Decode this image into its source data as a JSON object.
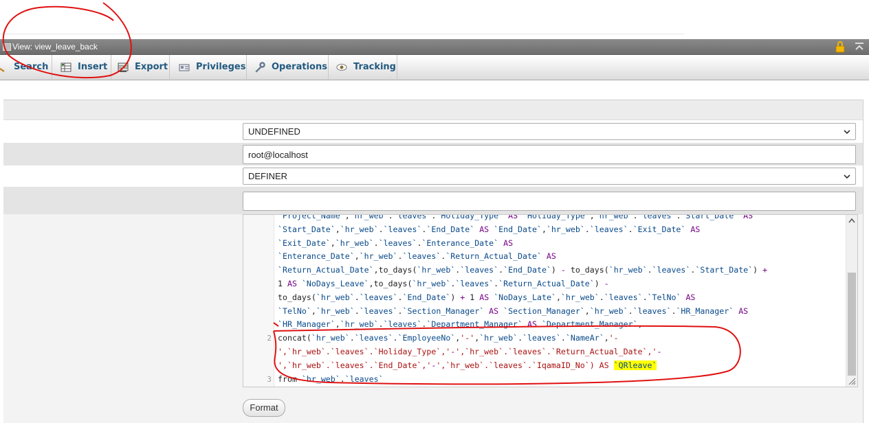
{
  "window": {
    "title": "View: view_leave_back"
  },
  "tabs": [
    {
      "label": "Search",
      "icon": "search-icon"
    },
    {
      "label": "Insert",
      "icon": "insert-icon"
    },
    {
      "label": "Export",
      "icon": "export-icon"
    },
    {
      "label": "Privileges",
      "icon": "privileges-icon"
    },
    {
      "label": "Operations",
      "icon": "wrench-icon"
    },
    {
      "label": "Tracking",
      "icon": "eye-icon"
    }
  ],
  "form": {
    "algorithm": {
      "value": "UNDEFINED"
    },
    "definer": {
      "value": "root@localhost"
    },
    "security": {
      "value": "DEFINER"
    },
    "check_option": {
      "value": ""
    }
  },
  "editor": {
    "lines": [
      {
        "num": "",
        "text": "`Project_Name`,`hr_web`.`leaves`.`Holiday_Type` AS `Holiday_Type`,`hr_web`.`leaves`.`Start_Date` AS"
      },
      {
        "num": "",
        "text": "`Start_Date`,`hr_web`.`leaves`.`End_Date` AS `End_Date`,`hr_web`.`leaves`.`Exit_Date` AS"
      },
      {
        "num": "",
        "text": "`Exit_Date`,`hr_web`.`leaves`.`Enterance_Date` AS"
      },
      {
        "num": "",
        "text": "`Enterance_Date`,`hr_web`.`leaves`.`Return_Actual_Date` AS"
      },
      {
        "num": "",
        "text": "`Return_Actual_Date`,to_days(`hr_web`.`leaves`.`End_Date`) - to_days(`hr_web`.`leaves`.`Start_Date`) +"
      },
      {
        "num": "",
        "text": "1 AS `NoDays_Leave`,to_days(`hr_web`.`leaves`.`Return_Actual_Date`) -"
      },
      {
        "num": "",
        "text": "to_days(`hr_web`.`leaves`.`End_Date`) + 1 AS `NoDays_Late`,`hr_web`.`leaves`.`TelNo` AS"
      },
      {
        "num": "",
        "text": "`TelNo`,`hr_web`.`leaves`.`Section_Manager` AS `Section_Manager`,`hr_web`.`leaves`.`HR_Manager` AS"
      },
      {
        "num": "",
        "text": "`HR_Manager`,`hr_web`.`leaves`.`Department_Manager` AS `Department_Manager`,"
      },
      {
        "num": "2",
        "text": "concat(`hr_web`.`leaves`.`EmployeeNo`,'-',`hr_web`.`leaves`.`NameAr`,'-"
      },
      {
        "num": "",
        "text": "',`hr_web`.`leaves`.`Holiday_Type`,'-',`hr_web`.`leaves`.`Return_Actual_Date`,'-"
      },
      {
        "num": "",
        "text": "',`hr_web`.`leaves`.`End_Date`,'-',`hr_web`.`leaves`.`IqamaID_No`) AS ",
        "highlight": "`QRleave`"
      },
      {
        "num": "3",
        "text": "from `hr_web`.`leaves`"
      }
    ]
  },
  "buttons": {
    "format": "Format"
  }
}
